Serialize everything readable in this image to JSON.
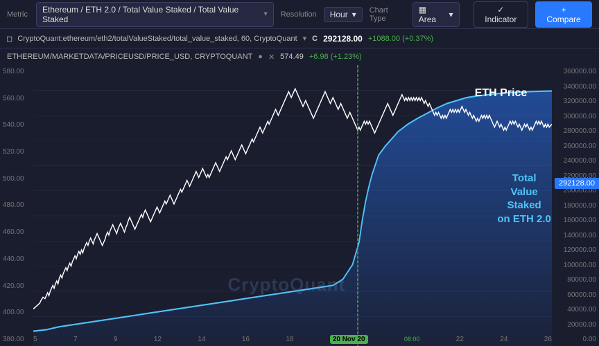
{
  "topbar": {
    "metric_label": "Metric",
    "metric_value": "Ethereum / ETH 2.0 / Total Value Staked / Total Value Staked",
    "resolution_label": "Resolution",
    "resolution_value": "Hour",
    "chart_type_label": "Chart Type",
    "chart_type_icon": "▦ Area",
    "indicator_label": "✓ Indicator",
    "compare_label": "+ Compare"
  },
  "series1": {
    "icon": "□",
    "name": "CryptoQuant:ethereum/eth2/totalValueStaked/total_value_staked, 60, CryptoQuant",
    "chevron": "▾",
    "tooltip_prefix": "C",
    "tooltip_value": "292128.00",
    "tooltip_change": "+1088.00 (+0.37%)"
  },
  "series2": {
    "name": "ETHEREUM/MARKETDATA/PRICEUSD/PRICE_USD, CRYPTOQUANT",
    "controls": [
      "●",
      "✕"
    ],
    "value": "574.49",
    "change": "+6.98 (+1.23%)"
  },
  "left_axis": {
    "labels": [
      "580.00",
      "560.00",
      "540.00",
      "520.00",
      "500.00",
      "480.00",
      "460.00",
      "440.00",
      "420.00",
      "400.00",
      "380.00"
    ]
  },
  "right_axis": {
    "labels": [
      "360000.00",
      "340000.00",
      "320000.00",
      "300000.00",
      "280000.00",
      "260000.00",
      "240000.00",
      "220000.00",
      "200000.00",
      "180000.00",
      "160000.00",
      "140000.00",
      "120000.00",
      "100000.00",
      "80000.00",
      "60000.00",
      "40000.00",
      "20000.00",
      "0.00"
    ]
  },
  "x_axis": {
    "labels": [
      "5",
      "7",
      "9",
      "12",
      "14",
      "16",
      "18",
      "20 Nov 20",
      "22",
      "24",
      "26"
    ]
  },
  "chart_labels": {
    "eth_price": "ETH Price",
    "tvs": "Total\nValue\nStaked\non ETH 2.0",
    "cryptoquant": "CryptoQuant"
  },
  "price_tag": {
    "value": "292128.00"
  },
  "colors": {
    "background": "#1a1d2e",
    "accent_blue": "#2979ff",
    "green": "#4caf50",
    "eth_line": "#ffffff",
    "tvs_line": "#4fc3f7",
    "tvs_fill": "rgba(41,121,255,0.3)",
    "vertical_line": "#4caf50"
  }
}
